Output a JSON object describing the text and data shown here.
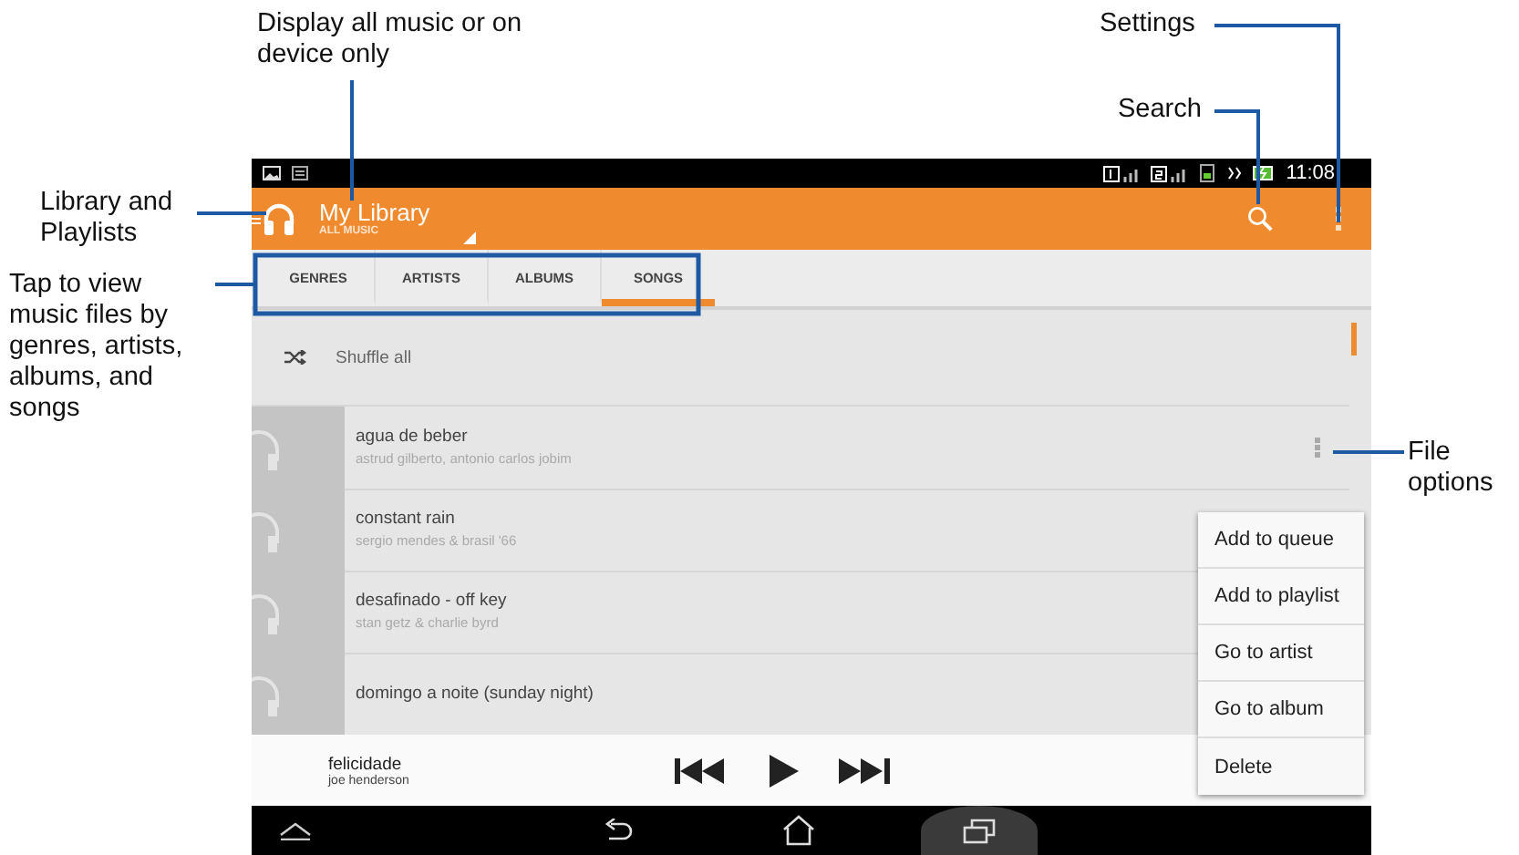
{
  "callouts": [
    {
      "text": "Display all music or on device only"
    },
    {
      "text": "Library and Playlists"
    },
    {
      "text": "Tap to view music files by genres, artists, albums, and songs"
    },
    {
      "text": "Settings"
    },
    {
      "text": "Search"
    },
    {
      "text": "File options"
    }
  ],
  "status_bar": {
    "time": "11:08"
  },
  "app_bar": {
    "title": "My Library",
    "subtitle": "ALL MUSIC"
  },
  "tabs": [
    {
      "label": "GENRES",
      "selected": false
    },
    {
      "label": "ARTISTS",
      "selected": false
    },
    {
      "label": "ALBUMS",
      "selected": false
    },
    {
      "label": "SONGS",
      "selected": true
    }
  ],
  "list": {
    "shuffle": "Shuffle all",
    "songs": [
      {
        "title": "agua de beber",
        "artist": "astrud gilberto, antonio carlos jobim"
      },
      {
        "title": "constant rain",
        "artist": "sergio mendes & brasil '66"
      },
      {
        "title": "desafinado - off key",
        "artist": "stan getz & charlie byrd"
      },
      {
        "title": "domingo a noite (sunday night)"
      }
    ]
  },
  "player": {
    "title": "felicidade",
    "artist": "joe henderson"
  },
  "menu": [
    "Add to queue",
    "Add to playlist",
    "Go to artist",
    "Go to album",
    "Delete"
  ]
}
